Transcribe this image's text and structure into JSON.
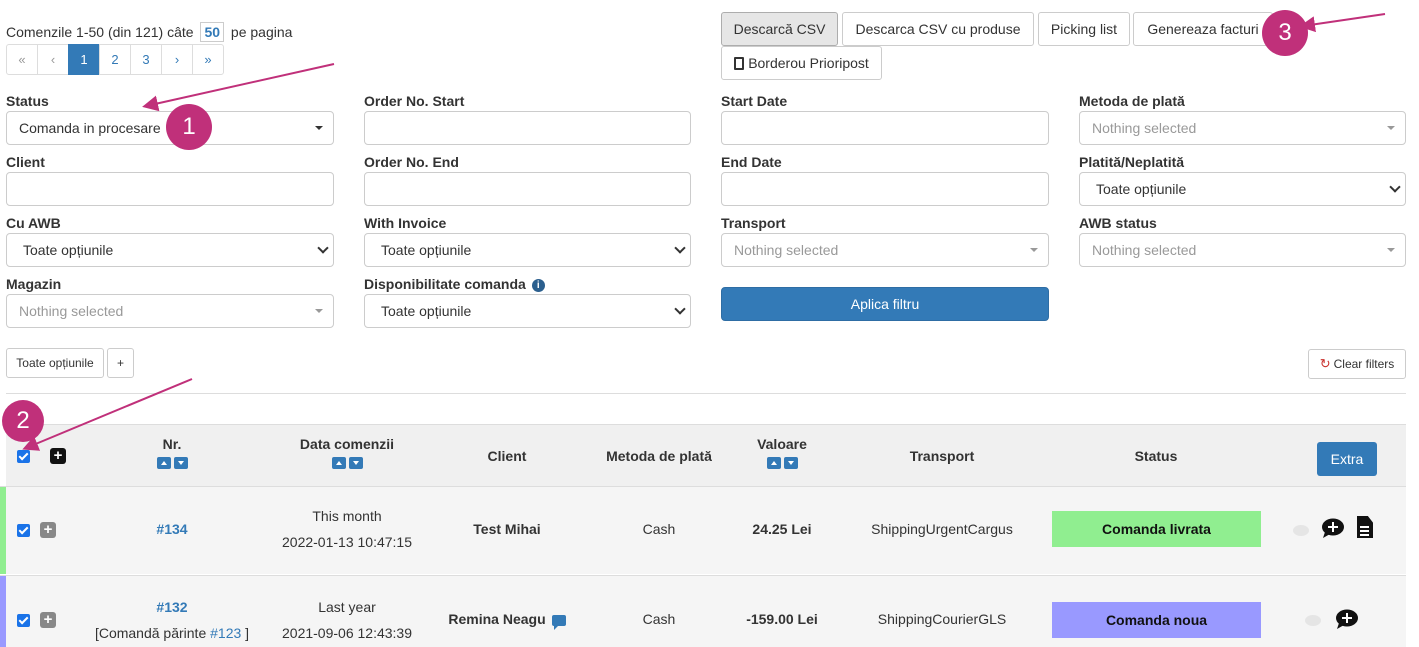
{
  "pagination": {
    "summary_prefix": "Comenzile 1-50 (din 121) câte",
    "per_page": "50",
    "summary_suffix": "pe pagina",
    "pages": [
      "«",
      "‹",
      "1",
      "2",
      "3",
      "›",
      "»"
    ]
  },
  "toolbar": {
    "csv": "Descarcă CSV",
    "csv_products": "Descarca CSV cu produse",
    "picking": "Picking list",
    "invoices": "Genereaza facturi",
    "borderou": "Borderou Prioripost"
  },
  "filters": {
    "status": {
      "label": "Status",
      "value": "Comanda in procesare"
    },
    "order_start": {
      "label": "Order No. Start",
      "value": ""
    },
    "start_date": {
      "label": "Start Date",
      "value": ""
    },
    "payment": {
      "label": "Metoda de plată",
      "value": "Nothing selected"
    },
    "client": {
      "label": "Client",
      "value": ""
    },
    "order_end": {
      "label": "Order No. End",
      "value": ""
    },
    "end_date": {
      "label": "End Date",
      "value": ""
    },
    "paid": {
      "label": "Platită/Neplatită",
      "value": "Toate opțiunile"
    },
    "awb": {
      "label": "Cu AWB",
      "value": "Toate opțiunile"
    },
    "invoice": {
      "label": "With Invoice",
      "value": "Toate opțiunile"
    },
    "transport": {
      "label": "Transport",
      "value": "Nothing selected"
    },
    "awb_status": {
      "label": "AWB status",
      "value": "Nothing selected"
    },
    "shop": {
      "label": "Magazin",
      "value": "Nothing selected"
    },
    "availability": {
      "label": "Disponibilitate comanda",
      "value": "Toate opțiunile"
    },
    "apply": "Aplica filtru"
  },
  "toggles": {
    "all": "Toate opțiunile",
    "plus": "+",
    "clear": "Clear filters"
  },
  "table": {
    "headers": [
      "Nr.",
      "Data comenzii",
      "Client",
      "Metoda de plată",
      "Valoare",
      "Transport",
      "Status"
    ],
    "extra": "Extra",
    "rows": [
      {
        "nr": "#134",
        "date_label": "This month",
        "date": "2022-01-13 10:47:15",
        "client": "Test Mihai",
        "payment": "Cash",
        "value": "24.25 Lei",
        "transport": "ShippingUrgentCargus",
        "status": "Comanda livrata",
        "status_color": "#90ee90",
        "bar_color": "#90ee90"
      },
      {
        "nr": "#132",
        "parent_prefix": "[Comandă părinte",
        "parent": "#123",
        "parent_suffix": "]",
        "date_label": "Last year",
        "date": "2021-09-06 12:43:39",
        "client": "Remina Neagu",
        "payment": "Cash",
        "value": "-159.00 Lei",
        "transport": "ShippingCourierGLS",
        "status": "Comanda noua",
        "status_color": "#9999ff",
        "bar_color": "#9999ff"
      }
    ]
  },
  "annotations": [
    "1",
    "2",
    "3"
  ],
  "colors": {
    "primary": "#337ab7",
    "annotation": "#c0307a"
  }
}
